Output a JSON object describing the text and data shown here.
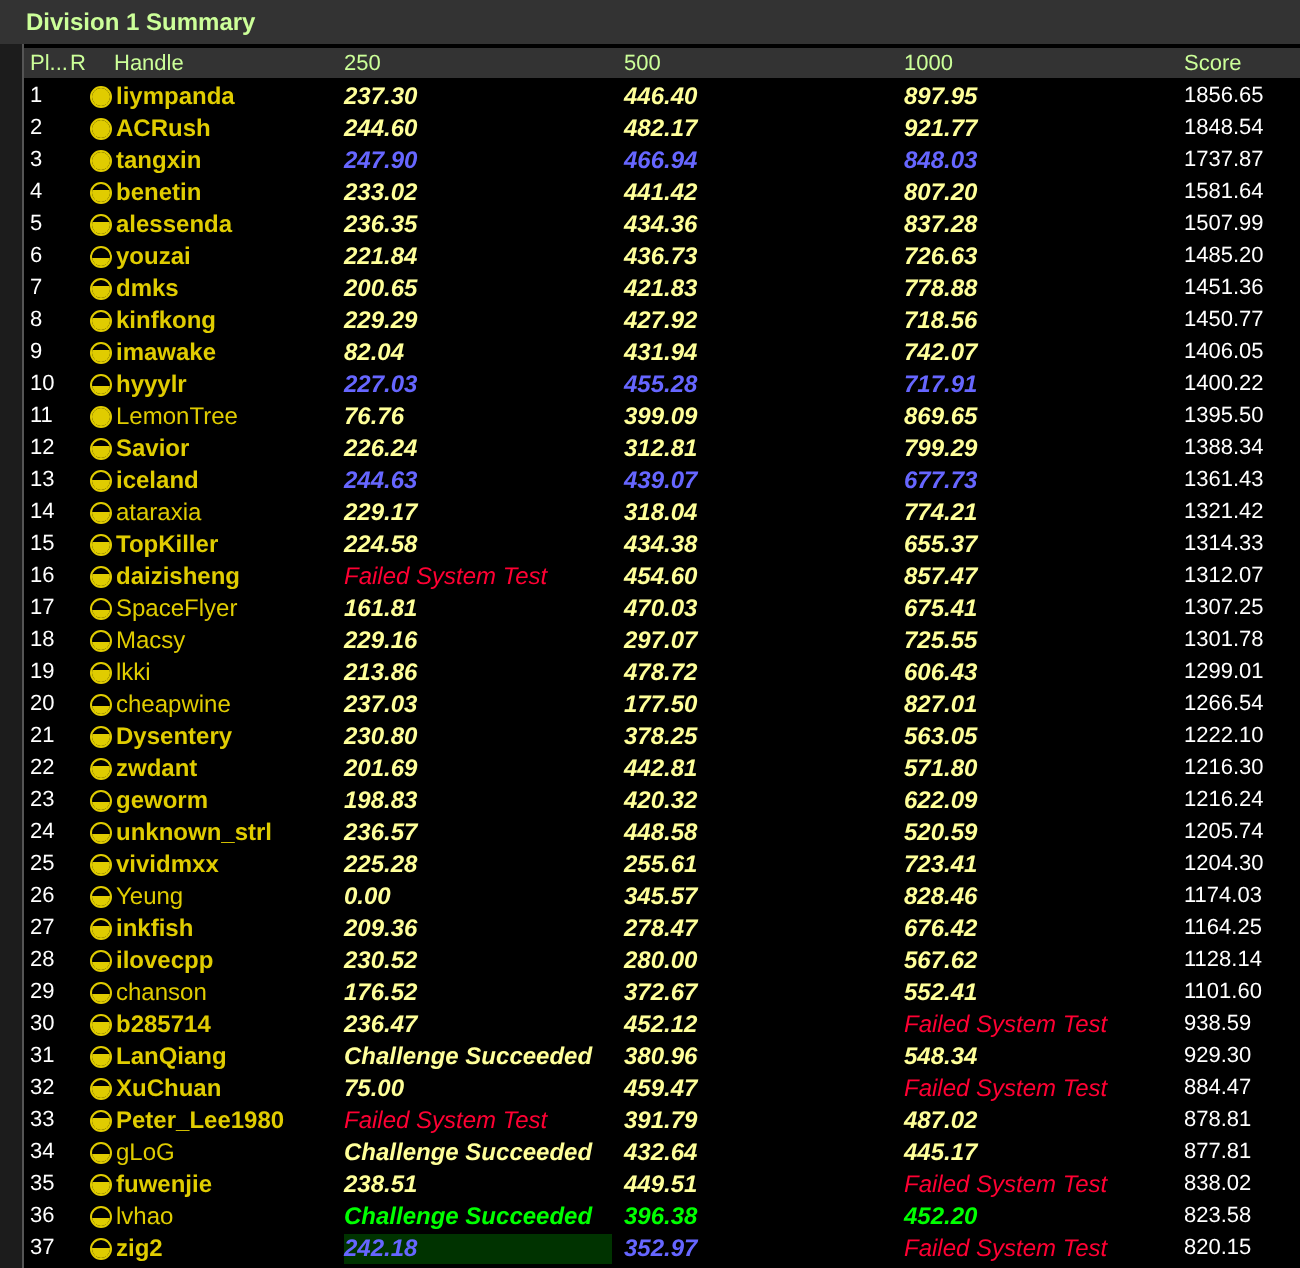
{
  "window": {
    "title": "Division 1 Summary"
  },
  "columns": [
    "Pl...",
    "R",
    "Handle",
    "250",
    "500",
    "1000",
    "Score"
  ],
  "rows": [
    {
      "place": "1",
      "rating_icon": {
        "kind": "full"
      },
      "handle": "liympanda",
      "bold": true,
      "problems": [
        {
          "text": "237.30",
          "kind": "normal",
          "selected": false
        },
        {
          "text": "446.40",
          "kind": "normal",
          "selected": false
        },
        {
          "text": "897.95",
          "kind": "normal",
          "selected": false
        }
      ],
      "score": "1856.65"
    },
    {
      "place": "2",
      "rating_icon": {
        "kind": "full"
      },
      "handle": "ACRush",
      "bold": true,
      "problems": [
        {
          "text": "244.60",
          "kind": "normal",
          "selected": false
        },
        {
          "text": "482.17",
          "kind": "normal",
          "selected": false
        },
        {
          "text": "921.77",
          "kind": "normal",
          "selected": false
        }
      ],
      "score": "1848.54"
    },
    {
      "place": "3",
      "rating_icon": {
        "kind": "full"
      },
      "handle": "tangxin",
      "bold": true,
      "problems": [
        {
          "text": "247.90",
          "kind": "blue",
          "selected": false
        },
        {
          "text": "466.94",
          "kind": "blue",
          "selected": false
        },
        {
          "text": "848.03",
          "kind": "blue",
          "selected": false
        }
      ],
      "score": "1737.87"
    },
    {
      "place": "4",
      "rating_icon": {
        "kind": "high"
      },
      "handle": "benetin",
      "bold": true,
      "problems": [
        {
          "text": "233.02",
          "kind": "normal",
          "selected": false
        },
        {
          "text": "441.42",
          "kind": "normal",
          "selected": false
        },
        {
          "text": "807.20",
          "kind": "normal",
          "selected": false
        }
      ],
      "score": "1581.64"
    },
    {
      "place": "5",
      "rating_icon": {
        "kind": "high"
      },
      "handle": "alessenda",
      "bold": true,
      "problems": [
        {
          "text": "236.35",
          "kind": "normal",
          "selected": false
        },
        {
          "text": "434.36",
          "kind": "normal",
          "selected": false
        },
        {
          "text": "837.28",
          "kind": "normal",
          "selected": false
        }
      ],
      "score": "1507.99"
    },
    {
      "place": "6",
      "rating_icon": {
        "kind": "low"
      },
      "handle": "youzai",
      "bold": true,
      "problems": [
        {
          "text": "221.84",
          "kind": "normal",
          "selected": false
        },
        {
          "text": "436.73",
          "kind": "normal",
          "selected": false
        },
        {
          "text": "726.63",
          "kind": "normal",
          "selected": false
        }
      ],
      "score": "1485.20"
    },
    {
      "place": "7",
      "rating_icon": {
        "kind": "high"
      },
      "handle": "dmks",
      "bold": true,
      "problems": [
        {
          "text": "200.65",
          "kind": "normal",
          "selected": false
        },
        {
          "text": "421.83",
          "kind": "normal",
          "selected": false
        },
        {
          "text": "778.88",
          "kind": "normal",
          "selected": false
        }
      ],
      "score": "1451.36"
    },
    {
      "place": "8",
      "rating_icon": {
        "kind": "high"
      },
      "handle": "kinfkong",
      "bold": true,
      "problems": [
        {
          "text": "229.29",
          "kind": "normal",
          "selected": false
        },
        {
          "text": "427.92",
          "kind": "normal",
          "selected": false
        },
        {
          "text": "718.56",
          "kind": "normal",
          "selected": false
        }
      ],
      "score": "1450.77"
    },
    {
      "place": "9",
      "rating_icon": {
        "kind": "high"
      },
      "handle": "imawake",
      "bold": true,
      "problems": [
        {
          "text": "82.04",
          "kind": "normal",
          "selected": false
        },
        {
          "text": "431.94",
          "kind": "normal",
          "selected": false
        },
        {
          "text": "742.07",
          "kind": "normal",
          "selected": false
        }
      ],
      "score": "1406.05"
    },
    {
      "place": "10",
      "rating_icon": {
        "kind": "low"
      },
      "handle": "hyyylr",
      "bold": true,
      "problems": [
        {
          "text": "227.03",
          "kind": "blue",
          "selected": false
        },
        {
          "text": "455.28",
          "kind": "blue",
          "selected": false
        },
        {
          "text": "717.91",
          "kind": "blue",
          "selected": false
        }
      ],
      "score": "1400.22"
    },
    {
      "place": "11",
      "rating_icon": {
        "kind": "full"
      },
      "handle": "LemonTree",
      "bold": false,
      "problems": [
        {
          "text": "76.76",
          "kind": "normal",
          "selected": false
        },
        {
          "text": "399.09",
          "kind": "normal",
          "selected": false
        },
        {
          "text": "869.65",
          "kind": "normal",
          "selected": false
        }
      ],
      "score": "1395.50"
    },
    {
      "place": "12",
      "rating_icon": {
        "kind": "high"
      },
      "handle": "Savior",
      "bold": true,
      "problems": [
        {
          "text": "226.24",
          "kind": "normal",
          "selected": false
        },
        {
          "text": "312.81",
          "kind": "normal",
          "selected": false
        },
        {
          "text": "799.29",
          "kind": "normal",
          "selected": false
        }
      ],
      "score": "1388.34"
    },
    {
      "place": "13",
      "rating_icon": {
        "kind": "half"
      },
      "handle": "iceland",
      "bold": true,
      "problems": [
        {
          "text": "244.63",
          "kind": "blue",
          "selected": false
        },
        {
          "text": "439.07",
          "kind": "blue",
          "selected": false
        },
        {
          "text": "677.73",
          "kind": "blue",
          "selected": false
        }
      ],
      "score": "1361.43"
    },
    {
      "place": "14",
      "rating_icon": {
        "kind": "half"
      },
      "handle": "ataraxia",
      "bold": false,
      "problems": [
        {
          "text": "229.17",
          "kind": "normal",
          "selected": false
        },
        {
          "text": "318.04",
          "kind": "normal",
          "selected": false
        },
        {
          "text": "774.21",
          "kind": "normal",
          "selected": false
        }
      ],
      "score": "1321.42"
    },
    {
      "place": "15",
      "rating_icon": {
        "kind": "high"
      },
      "handle": "TopKiller",
      "bold": true,
      "problems": [
        {
          "text": "224.58",
          "kind": "normal",
          "selected": false
        },
        {
          "text": "434.38",
          "kind": "normal",
          "selected": false
        },
        {
          "text": "655.37",
          "kind": "normal",
          "selected": false
        }
      ],
      "score": "1314.33"
    },
    {
      "place": "16",
      "rating_icon": {
        "kind": "high"
      },
      "handle": "daizisheng",
      "bold": true,
      "problems": [
        {
          "text": "Failed System Test",
          "kind": "failed",
          "selected": false
        },
        {
          "text": "454.60",
          "kind": "normal",
          "selected": false
        },
        {
          "text": "857.47",
          "kind": "normal",
          "selected": false
        }
      ],
      "score": "1312.07"
    },
    {
      "place": "17",
      "rating_icon": {
        "kind": "low"
      },
      "handle": "SpaceFlyer",
      "bold": false,
      "problems": [
        {
          "text": "161.81",
          "kind": "normal",
          "selected": false
        },
        {
          "text": "470.03",
          "kind": "normal",
          "selected": false
        },
        {
          "text": "675.41",
          "kind": "normal",
          "selected": false
        }
      ],
      "score": "1307.25"
    },
    {
      "place": "18",
      "rating_icon": {
        "kind": "low"
      },
      "handle": "Macsy",
      "bold": false,
      "problems": [
        {
          "text": "229.16",
          "kind": "normal",
          "selected": false
        },
        {
          "text": "297.07",
          "kind": "normal",
          "selected": false
        },
        {
          "text": "725.55",
          "kind": "normal",
          "selected": false
        }
      ],
      "score": "1301.78"
    },
    {
      "place": "19",
      "rating_icon": {
        "kind": "high"
      },
      "handle": "lkki",
      "bold": false,
      "problems": [
        {
          "text": "213.86",
          "kind": "normal",
          "selected": false
        },
        {
          "text": "478.72",
          "kind": "normal",
          "selected": false
        },
        {
          "text": "606.43",
          "kind": "normal",
          "selected": false
        }
      ],
      "score": "1299.01"
    },
    {
      "place": "20",
      "rating_icon": {
        "kind": "low"
      },
      "handle": "cheapwine",
      "bold": false,
      "problems": [
        {
          "text": "237.03",
          "kind": "normal",
          "selected": false
        },
        {
          "text": "177.50",
          "kind": "normal",
          "selected": false
        },
        {
          "text": "827.01",
          "kind": "normal",
          "selected": false
        }
      ],
      "score": "1266.54"
    },
    {
      "place": "21",
      "rating_icon": {
        "kind": "high"
      },
      "handle": "Dysentery",
      "bold": true,
      "problems": [
        {
          "text": "230.80",
          "kind": "normal",
          "selected": false
        },
        {
          "text": "378.25",
          "kind": "normal",
          "selected": false
        },
        {
          "text": "563.05",
          "kind": "normal",
          "selected": false
        }
      ],
      "score": "1222.10"
    },
    {
      "place": "22",
      "rating_icon": {
        "kind": "high"
      },
      "handle": "zwdant",
      "bold": true,
      "problems": [
        {
          "text": "201.69",
          "kind": "normal",
          "selected": false
        },
        {
          "text": "442.81",
          "kind": "normal",
          "selected": false
        },
        {
          "text": "571.80",
          "kind": "normal",
          "selected": false
        }
      ],
      "score": "1216.30"
    },
    {
      "place": "23",
      "rating_icon": {
        "kind": "low"
      },
      "handle": "geworm",
      "bold": true,
      "problems": [
        {
          "text": "198.83",
          "kind": "normal",
          "selected": false
        },
        {
          "text": "420.32",
          "kind": "normal",
          "selected": false
        },
        {
          "text": "622.09",
          "kind": "normal",
          "selected": false
        }
      ],
      "score": "1216.24"
    },
    {
      "place": "24",
      "rating_icon": {
        "kind": "low"
      },
      "handle": "unknown_strl",
      "bold": true,
      "problems": [
        {
          "text": "236.57",
          "kind": "normal",
          "selected": false
        },
        {
          "text": "448.58",
          "kind": "normal",
          "selected": false
        },
        {
          "text": "520.59",
          "kind": "normal",
          "selected": false
        }
      ],
      "score": "1205.74"
    },
    {
      "place": "25",
      "rating_icon": {
        "kind": "high"
      },
      "handle": "vividmxx",
      "bold": true,
      "problems": [
        {
          "text": "225.28",
          "kind": "normal",
          "selected": false
        },
        {
          "text": "255.61",
          "kind": "normal",
          "selected": false
        },
        {
          "text": "723.41",
          "kind": "normal",
          "selected": false
        }
      ],
      "score": "1204.30"
    },
    {
      "place": "26",
      "rating_icon": {
        "kind": "half"
      },
      "handle": "Yeung",
      "bold": false,
      "problems": [
        {
          "text": "0.00",
          "kind": "normal",
          "selected": false
        },
        {
          "text": "345.57",
          "kind": "normal",
          "selected": false
        },
        {
          "text": "828.46",
          "kind": "normal",
          "selected": false
        }
      ],
      "score": "1174.03"
    },
    {
      "place": "27",
      "rating_icon": {
        "kind": "high"
      },
      "handle": "inkfish",
      "bold": true,
      "problems": [
        {
          "text": "209.36",
          "kind": "normal",
          "selected": false
        },
        {
          "text": "278.47",
          "kind": "normal",
          "selected": false
        },
        {
          "text": "676.42",
          "kind": "normal",
          "selected": false
        }
      ],
      "score": "1164.25"
    },
    {
      "place": "28",
      "rating_icon": {
        "kind": "low"
      },
      "handle": "ilovecpp",
      "bold": true,
      "problems": [
        {
          "text": "230.52",
          "kind": "normal",
          "selected": false
        },
        {
          "text": "280.00",
          "kind": "normal",
          "selected": false
        },
        {
          "text": "567.62",
          "kind": "normal",
          "selected": false
        }
      ],
      "score": "1128.14"
    },
    {
      "place": "29",
      "rating_icon": {
        "kind": "low"
      },
      "handle": "chanson",
      "bold": false,
      "problems": [
        {
          "text": "176.52",
          "kind": "normal",
          "selected": false
        },
        {
          "text": "372.67",
          "kind": "normal",
          "selected": false
        },
        {
          "text": "552.41",
          "kind": "normal",
          "selected": false
        }
      ],
      "score": "1101.60"
    },
    {
      "place": "30",
      "rating_icon": {
        "kind": "high"
      },
      "handle": "b285714",
      "bold": true,
      "problems": [
        {
          "text": "236.47",
          "kind": "normal",
          "selected": false
        },
        {
          "text": "452.12",
          "kind": "normal",
          "selected": false
        },
        {
          "text": "Failed System Test",
          "kind": "failed",
          "selected": false
        }
      ],
      "score": "938.59"
    },
    {
      "place": "31",
      "rating_icon": {
        "kind": "high"
      },
      "handle": "LanQiang",
      "bold": true,
      "problems": [
        {
          "text": "Challenge Succeeded",
          "kind": "normal",
          "selected": false
        },
        {
          "text": "380.96",
          "kind": "normal",
          "selected": false
        },
        {
          "text": "548.34",
          "kind": "normal",
          "selected": false
        }
      ],
      "score": "929.30"
    },
    {
      "place": "32",
      "rating_icon": {
        "kind": "high"
      },
      "handle": "XuChuan",
      "bold": true,
      "problems": [
        {
          "text": "75.00",
          "kind": "normal",
          "selected": false
        },
        {
          "text": "459.47",
          "kind": "normal",
          "selected": false
        },
        {
          "text": "Failed System Test",
          "kind": "failed",
          "selected": false
        }
      ],
      "score": "884.47"
    },
    {
      "place": "33",
      "rating_icon": {
        "kind": "high"
      },
      "handle": "Peter_Lee1980",
      "bold": true,
      "problems": [
        {
          "text": "Failed System Test",
          "kind": "failed",
          "selected": false
        },
        {
          "text": "391.79",
          "kind": "normal",
          "selected": false
        },
        {
          "text": "487.02",
          "kind": "normal",
          "selected": false
        }
      ],
      "score": "878.81"
    },
    {
      "place": "34",
      "rating_icon": {
        "kind": "low"
      },
      "handle": "gLoG",
      "bold": false,
      "problems": [
        {
          "text": "Challenge Succeeded",
          "kind": "normal",
          "selected": false
        },
        {
          "text": "432.64",
          "kind": "normal",
          "selected": false
        },
        {
          "text": "445.17",
          "kind": "normal",
          "selected": false
        }
      ],
      "score": "877.81"
    },
    {
      "place": "35",
      "rating_icon": {
        "kind": "high"
      },
      "handle": "fuwenjie",
      "bold": true,
      "problems": [
        {
          "text": "238.51",
          "kind": "normal",
          "selected": false
        },
        {
          "text": "449.51",
          "kind": "normal",
          "selected": false
        },
        {
          "text": "Failed System Test",
          "kind": "failed",
          "selected": false
        }
      ],
      "score": "838.02"
    },
    {
      "place": "36",
      "rating_icon": {
        "kind": "low"
      },
      "handle": "lvhao",
      "bold": false,
      "problems": [
        {
          "text": "Challenge Succeeded",
          "kind": "green",
          "selected": false
        },
        {
          "text": "396.38",
          "kind": "green",
          "selected": false
        },
        {
          "text": "452.20",
          "kind": "green",
          "selected": false
        }
      ],
      "score": "823.58"
    },
    {
      "place": "37",
      "rating_icon": {
        "kind": "half"
      },
      "handle": "zig2",
      "bold": true,
      "problems": [
        {
          "text": "242.18",
          "kind": "blue",
          "selected": true
        },
        {
          "text": "352.97",
          "kind": "blue",
          "selected": false
        },
        {
          "text": "Failed System Test",
          "kind": "failed",
          "selected": false
        }
      ],
      "score": "820.15"
    }
  ]
}
